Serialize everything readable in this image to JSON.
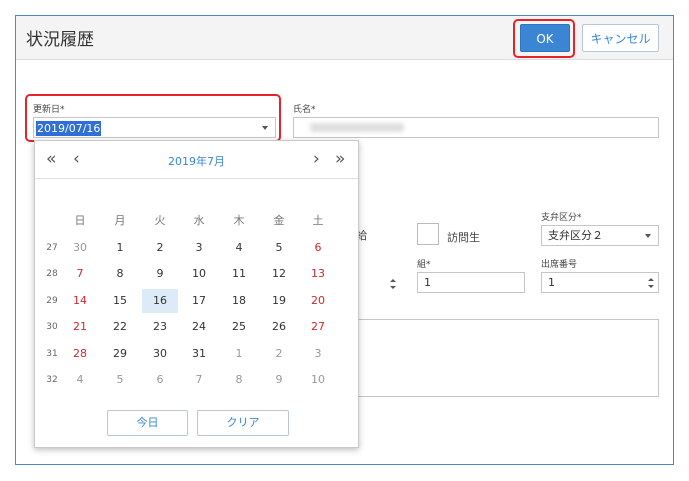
{
  "dialog": {
    "title": "状況履歴",
    "ok_label": "OK",
    "cancel_label": "キャンセル"
  },
  "form": {
    "update_date_label": "更新日*",
    "update_date_value": "2019/07/16",
    "name_label": "氏名*",
    "pay_partial": "給",
    "visit_label": "訪問生",
    "branch_label": "支弁区分*",
    "branch_value": "支弁区分２",
    "group_label": "組*",
    "group_value": "1",
    "seat_label": "出席番号",
    "seat_value": "1"
  },
  "calendar": {
    "month_title": "2019年7月",
    "weekdays": [
      "日",
      "月",
      "火",
      "水",
      "木",
      "金",
      "土"
    ],
    "weeks": [
      {
        "wk": "27",
        "days": [
          "30",
          "1",
          "2",
          "3",
          "4",
          "5",
          "6"
        ]
      },
      {
        "wk": "28",
        "days": [
          "7",
          "8",
          "9",
          "10",
          "11",
          "12",
          "13"
        ]
      },
      {
        "wk": "29",
        "days": [
          "14",
          "15",
          "16",
          "17",
          "18",
          "19",
          "20"
        ]
      },
      {
        "wk": "30",
        "days": [
          "21",
          "22",
          "23",
          "24",
          "25",
          "26",
          "27"
        ]
      },
      {
        "wk": "31",
        "days": [
          "28",
          "29",
          "30",
          "31",
          "1",
          "2",
          "3"
        ]
      },
      {
        "wk": "32",
        "days": [
          "4",
          "5",
          "6",
          "7",
          "8",
          "9",
          "10"
        ]
      }
    ],
    "today_label": "今日",
    "clear_label": "クリア"
  },
  "colors": {
    "accent": "#3a86d5",
    "highlight": "#e5232b",
    "weekend": "#d0282e"
  }
}
